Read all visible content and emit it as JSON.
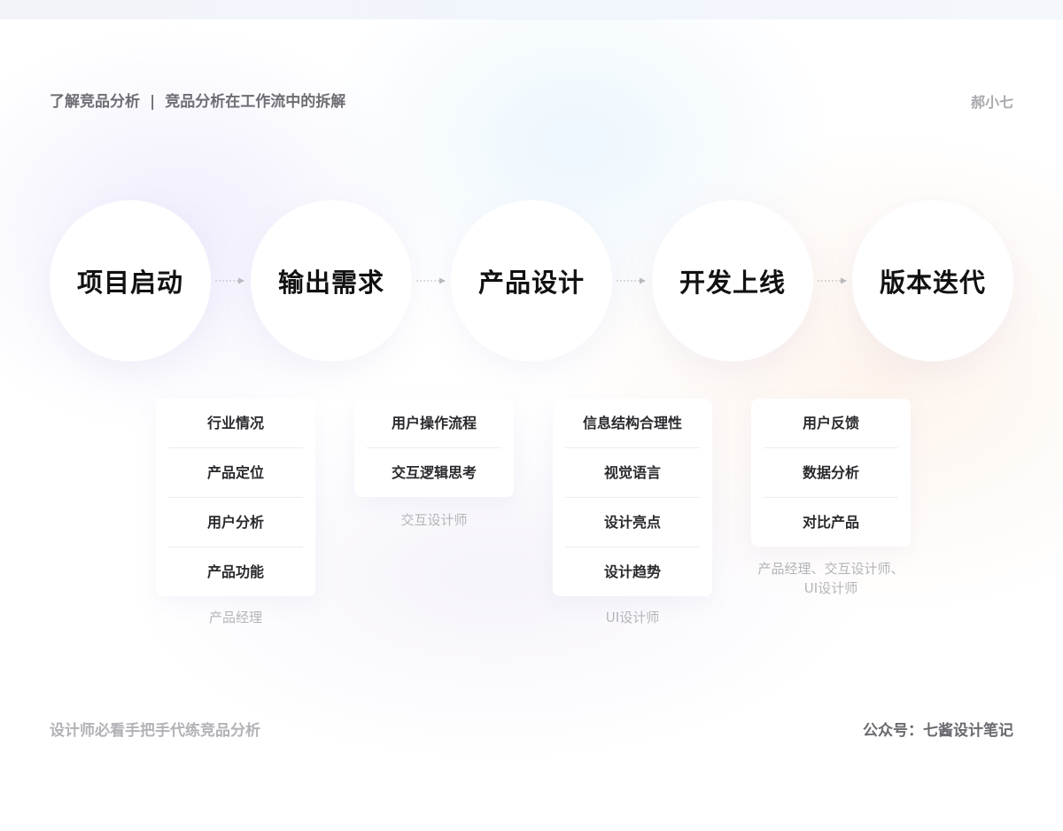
{
  "header": {
    "title_left": "了解竞品分析",
    "separator": "|",
    "title_right": "竞品分析在工作流中的拆解",
    "author": "郝小七"
  },
  "stages": [
    {
      "label": "项目启动"
    },
    {
      "label": "输出需求"
    },
    {
      "label": "产品设计"
    },
    {
      "label": "开发上线"
    },
    {
      "label": "版本迭代"
    }
  ],
  "cards": [
    {
      "items": [
        "行业情况",
        "产品定位",
        "用户分析",
        "产品功能"
      ],
      "role_lines": [
        "产品经理"
      ]
    },
    {
      "items": [
        "用户操作流程",
        "交互逻辑思考"
      ],
      "role_lines": [
        "交互设计师"
      ]
    },
    {
      "items": [
        "信息结构合理性",
        "视觉语言",
        "设计亮点",
        "设计趋势"
      ],
      "role_lines": [
        "UI设计师"
      ]
    },
    {
      "items": [
        "用户反馈",
        "数据分析",
        "对比产品"
      ],
      "role_lines": [
        "产品经理、交互设计师、",
        "UI设计师"
      ]
    }
  ],
  "footer": {
    "left": "设计师必看手把手代练竞品分析",
    "right": "公众号：七酱设计笔记"
  },
  "colors": {
    "stage_text": "#111111",
    "card_text": "#2a2a2e",
    "role_text": "#b4b4b9",
    "arrow": "#b8b8bf"
  }
}
